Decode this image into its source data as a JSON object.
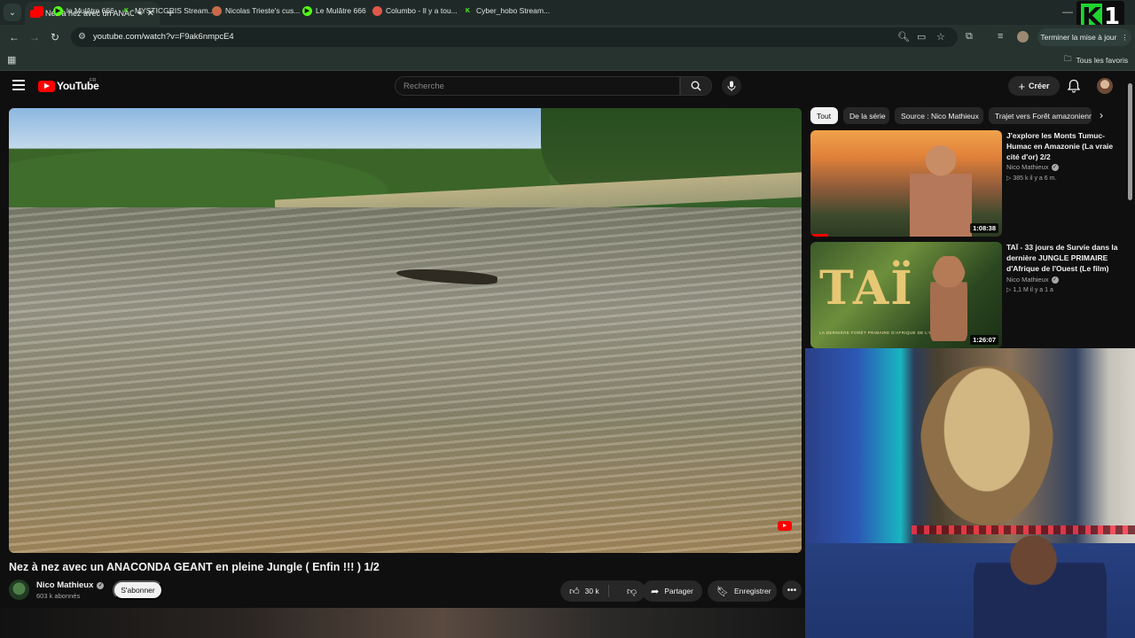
{
  "browser": {
    "tab_title": "Nez à nez avec un ANACONDA",
    "url": "youtube.com/watch?v=F9ak6nmpcE4",
    "update_button": "Terminer la mise à jour",
    "bookmarks": [
      {
        "label": "",
        "icon": "youtube-icon",
        "color": "#ff0000"
      },
      {
        "label": "le Mulâtre 666",
        "icon": "play-icon",
        "color": "#53fc18"
      },
      {
        "label": "MYSTICGRIS Stream...",
        "icon": "kick-icon",
        "color": "#53fc18"
      },
      {
        "label": "Nicolas Trieste's cus...",
        "icon": "profile-icon",
        "color": "#c86a4a"
      },
      {
        "label": "Le Mulâtre 666",
        "icon": "play-icon",
        "color": "#53fc18"
      },
      {
        "label": "Columbo - Il y a tou...",
        "icon": "globe-icon",
        "color": "#e0584a"
      },
      {
        "label": "Cyber_hobo Stream...",
        "icon": "kick-icon",
        "color": "#53fc18"
      }
    ],
    "all_favorites": "Tous les favoris"
  },
  "overlay_logo": {
    "letter": "K",
    "number": "1",
    "color": "#1ed52f"
  },
  "youtube": {
    "logo_text": "YouTube",
    "country": "FR",
    "search_placeholder": "Recherche",
    "create_label": "Créer",
    "accent": "#ff0000"
  },
  "video": {
    "title": "Nez à nez avec un ANACONDA GEANT en pleine Jungle ( Enfin !!! ) 1/2",
    "channel": "Nico Mathieux",
    "subscribers": "603 k abonnés",
    "subscribe_label": "S'abonner",
    "likes": "30 k",
    "share_label": "Partager",
    "save_label": "Enregistrer"
  },
  "chips": [
    "Tout",
    "De la série",
    "Source : Nico Mathieux",
    "Trajet vers Forêt amazonienne"
  ],
  "recommendations": [
    {
      "title": "J'explore les Monts Tumuc-Humac en Amazonie (La vraie cité d'or) 2/2",
      "channel": "Nico Mathieux",
      "meta": "▷ 385 k  il y a 6 m.",
      "duration": "1:08:38"
    },
    {
      "title": "TAÏ - 33 jours de Survie dans la dernière JUNGLE PRIMAIRE d'Afrique de l'Ouest (Le film)",
      "channel": "Nico Mathieux",
      "meta": "▷ 1,1 M  il y a 1 a",
      "duration": "1:26:07",
      "thumb_title": "TAÏ",
      "thumb_subtitle": "LA DERNIÈRE FORÊT PRIMAIRE D'AFRIQUE DE L'OUEST"
    }
  ]
}
